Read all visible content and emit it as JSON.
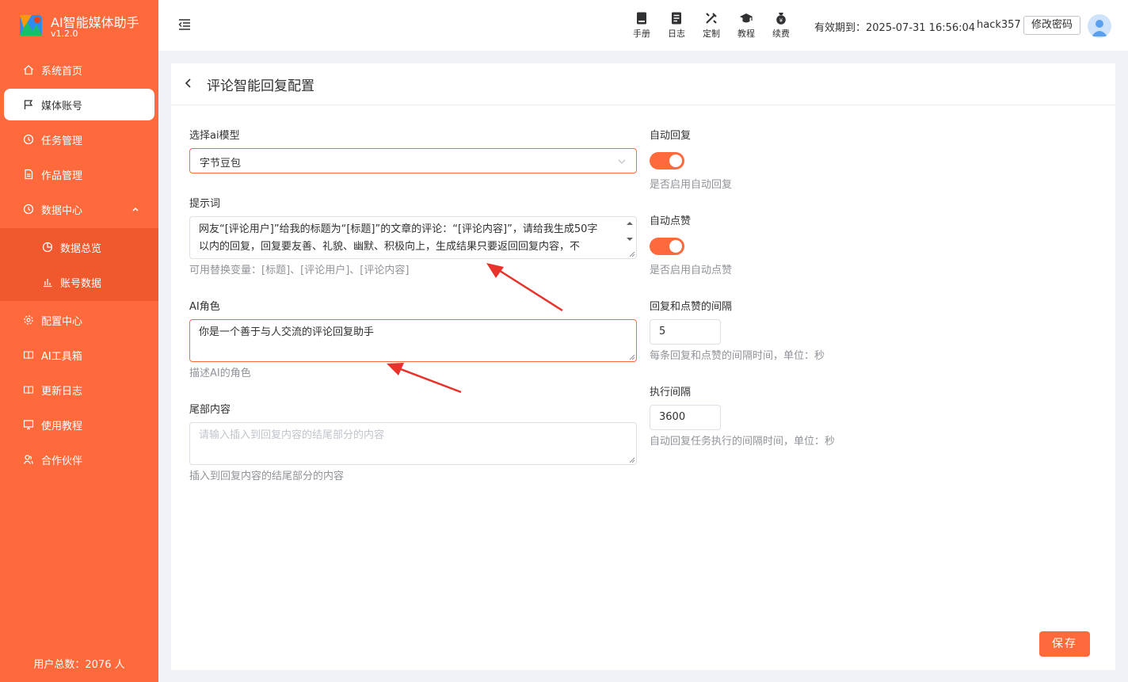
{
  "brand": {
    "name": "AI智能媒体助手",
    "version": "v1.2.0"
  },
  "sidebar": {
    "items": [
      {
        "label": "系统首页",
        "icon": "home-icon"
      },
      {
        "label": "媒体账号",
        "icon": "flag-icon"
      },
      {
        "label": "任务管理",
        "icon": "clock-icon"
      },
      {
        "label": "作品管理",
        "icon": "document-icon"
      },
      {
        "label": "数据中心",
        "icon": "clock-icon"
      },
      {
        "label": "数据总览",
        "icon": "pie-chart-icon"
      },
      {
        "label": "账号数据",
        "icon": "bar-chart-icon"
      },
      {
        "label": "配置中心",
        "icon": "gear-icon"
      },
      {
        "label": "AI工具箱",
        "icon": "book-icon"
      },
      {
        "label": "更新日志",
        "icon": "book-icon"
      },
      {
        "label": "使用教程",
        "icon": "monitor-icon"
      },
      {
        "label": "合作伙伴",
        "icon": "users-icon"
      }
    ],
    "user_total": "用户总数：2076 人"
  },
  "header": {
    "tools": [
      {
        "label": "手册",
        "icon": "manual-icon"
      },
      {
        "label": "日志",
        "icon": "log-icon"
      },
      {
        "label": "定制",
        "icon": "customize-icon"
      },
      {
        "label": "教程",
        "icon": "graduation-cap-icon"
      },
      {
        "label": "续费",
        "icon": "money-bag-icon"
      }
    ],
    "expiry": "有效期到：2025-07-31 16:56:04",
    "username": "hack357",
    "change_password": "修改密码"
  },
  "page": {
    "title": "评论智能回复配置",
    "ai_model": {
      "label": "选择ai模型",
      "value": "字节豆包"
    },
    "prompt": {
      "label": "提示词",
      "line1": "网友“[评论用户]”给我的标题为“[标题]”的文章的评论：“[评论内容]”，请给我生成50字",
      "line2": "以内的回复，回复要友善、礼貌、幽默、积极向上，生成结果只要返回回复内容，不",
      "hint": "可用替换变量：[标题]、[评论用户]、[评论内容]"
    },
    "ai_role": {
      "label": "AI角色",
      "value": "你是一个善于与人交流的评论回复助手",
      "hint": "描述AI的角色"
    },
    "tail": {
      "label": "尾部内容",
      "placeholder": "请输入插入到回复内容的结尾部分的内容",
      "hint": "插入到回复内容的结尾部分的内容"
    },
    "auto_reply": {
      "label": "自动回复",
      "on": true,
      "hint": "是否启用自动回复"
    },
    "auto_like": {
      "label": "自动点赞",
      "on": true,
      "hint": "是否启用自动点赞"
    },
    "interval": {
      "label": "回复和点赞的间隔",
      "value": "5",
      "hint": "每条回复和点赞的间隔时间，单位：秒"
    },
    "exec_interval": {
      "label": "执行间隔",
      "value": "3600",
      "hint": "自动回复任务执行的间隔时间，单位：秒"
    },
    "save": "保存"
  },
  "colors": {
    "accent": "#ff6a3c",
    "annotation_arrow": "#e8322a"
  }
}
